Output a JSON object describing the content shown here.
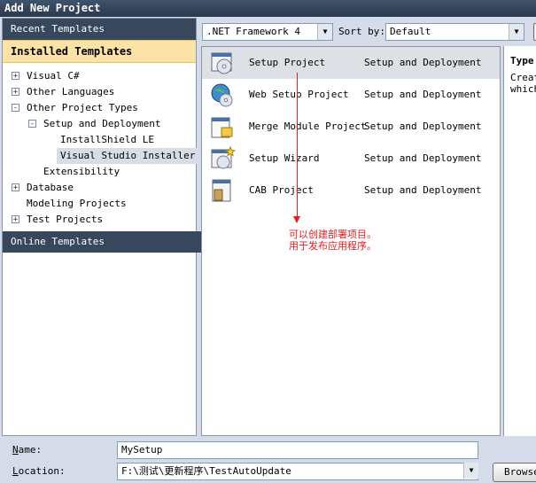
{
  "window": {
    "title": "Add New Project"
  },
  "left": {
    "recent_label": "Recent Templates",
    "installed_label": "Installed Templates",
    "online_label": "Online Templates",
    "tree": [
      {
        "label": "Visual C#",
        "expander": "+",
        "depth": 0,
        "selected": false
      },
      {
        "label": "Other Languages",
        "expander": "+",
        "depth": 0,
        "selected": false
      },
      {
        "label": "Other Project Types",
        "expander": "-",
        "depth": 0,
        "selected": false
      },
      {
        "label": "Setup and Deployment",
        "expander": "-",
        "depth": 1,
        "selected": false
      },
      {
        "label": "InstallShield LE",
        "expander": "",
        "depth": 2,
        "selected": false
      },
      {
        "label": "Visual Studio Installer",
        "expander": "",
        "depth": 2,
        "selected": true
      },
      {
        "label": "Extensibility",
        "expander": "",
        "depth": 1,
        "selected": false
      },
      {
        "label": "Database",
        "expander": "+",
        "depth": 0,
        "selected": false
      },
      {
        "label": "Modeling Projects",
        "expander": "",
        "depth": 0,
        "selected": false
      },
      {
        "label": "Test Projects",
        "expander": "+",
        "depth": 0,
        "selected": false
      }
    ]
  },
  "toolbar": {
    "framework": ".NET Framework 4",
    "sort_label": "Sort by:",
    "sort_value": "Default"
  },
  "templates": [
    {
      "name": "Setup Project",
      "category": "Setup and Deployment",
      "icon": "setup-project-icon",
      "selected": true
    },
    {
      "name": "Web Setup Project",
      "category": "Setup and Deployment",
      "icon": "web-setup-icon",
      "selected": false
    },
    {
      "name": "Merge Module Project",
      "category": "Setup and Deployment",
      "icon": "merge-module-icon",
      "selected": false
    },
    {
      "name": "Setup Wizard",
      "category": "Setup and Deployment",
      "icon": "setup-wizard-icon",
      "selected": false
    },
    {
      "name": "CAB Project",
      "category": "Setup and Deployment",
      "icon": "cab-project-icon",
      "selected": false
    }
  ],
  "annotation": {
    "line1": "可以创建部署项目。",
    "line2": "用于发布应用程序。",
    "color": "#e02020"
  },
  "info": {
    "type_label": "Type",
    "desc_line1": "Creat",
    "desc_line2": "which"
  },
  "form": {
    "name_label_key": "N",
    "name_label_rest": "ame:",
    "name_value": "MySetup",
    "location_label_key": "L",
    "location_label_rest": "ocation:",
    "location_value": "F:\\测试\\更新程序\\TestAutoUpdate",
    "browse_label": "Browse"
  },
  "colors": {
    "header_dark": "#36475e",
    "header_active": "#fbe3a8",
    "dialog_bg": "#d6dbe9"
  }
}
